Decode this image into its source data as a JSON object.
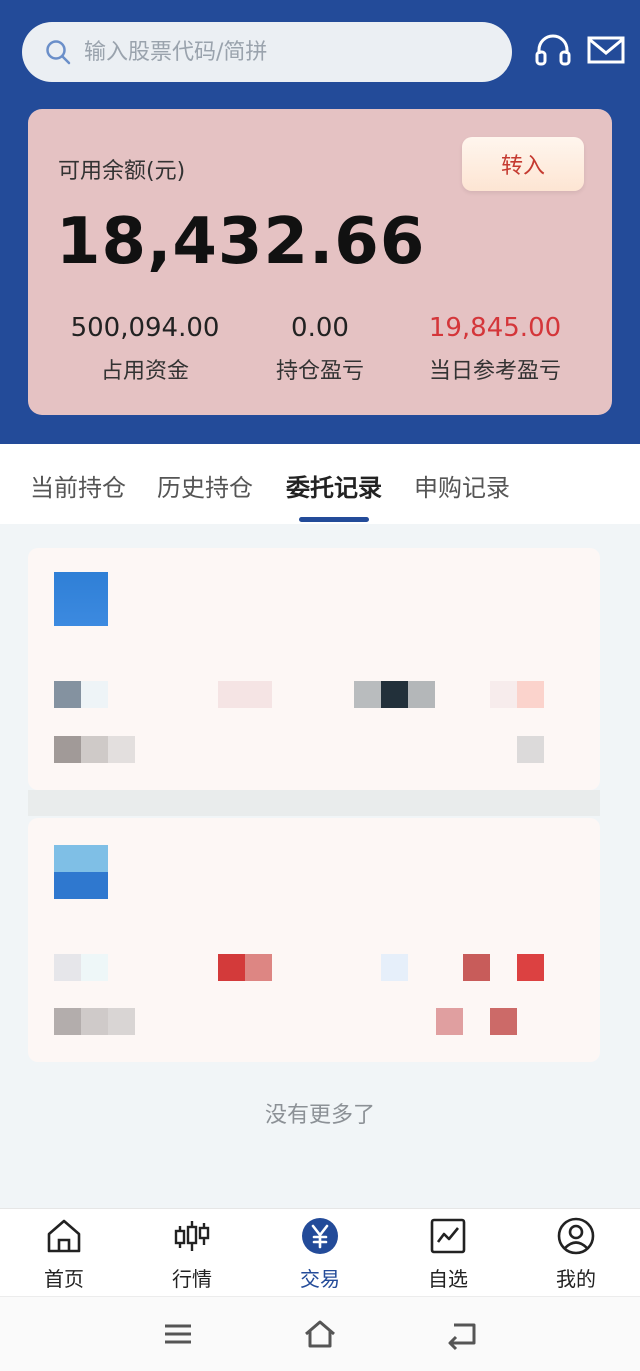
{
  "search": {
    "placeholder": "输入股票代码/简拼"
  },
  "header_icons": [
    "headset-icon",
    "mail-icon"
  ],
  "account": {
    "balance_label": "可用余额(元)",
    "transfer_label": "转入",
    "balance": "18,432.66",
    "stats": [
      {
        "value": "500,094.00",
        "label": "占用资金"
      },
      {
        "value": "0.00",
        "label": "持仓盈亏"
      },
      {
        "value": "19,845.00",
        "label": "当日参考盈亏"
      }
    ]
  },
  "tabs": [
    {
      "label": "当前持仓"
    },
    {
      "label": "历史持仓"
    },
    {
      "label": "委托记录",
      "active": true
    },
    {
      "label": "申购记录"
    }
  ],
  "records": {
    "end_text": "没有更多了"
  },
  "nav": [
    {
      "label": "首页",
      "icon": "home-icon"
    },
    {
      "label": "行情",
      "icon": "candlestick-icon"
    },
    {
      "label": "交易",
      "icon": "yen-icon",
      "active": true
    },
    {
      "label": "自选",
      "icon": "trend-chart-icon"
    },
    {
      "label": "我的",
      "icon": "user-icon"
    }
  ],
  "colors": {
    "brand": "#234b99",
    "card_bg": "#e5c2c3",
    "loss": "#d4363a"
  }
}
